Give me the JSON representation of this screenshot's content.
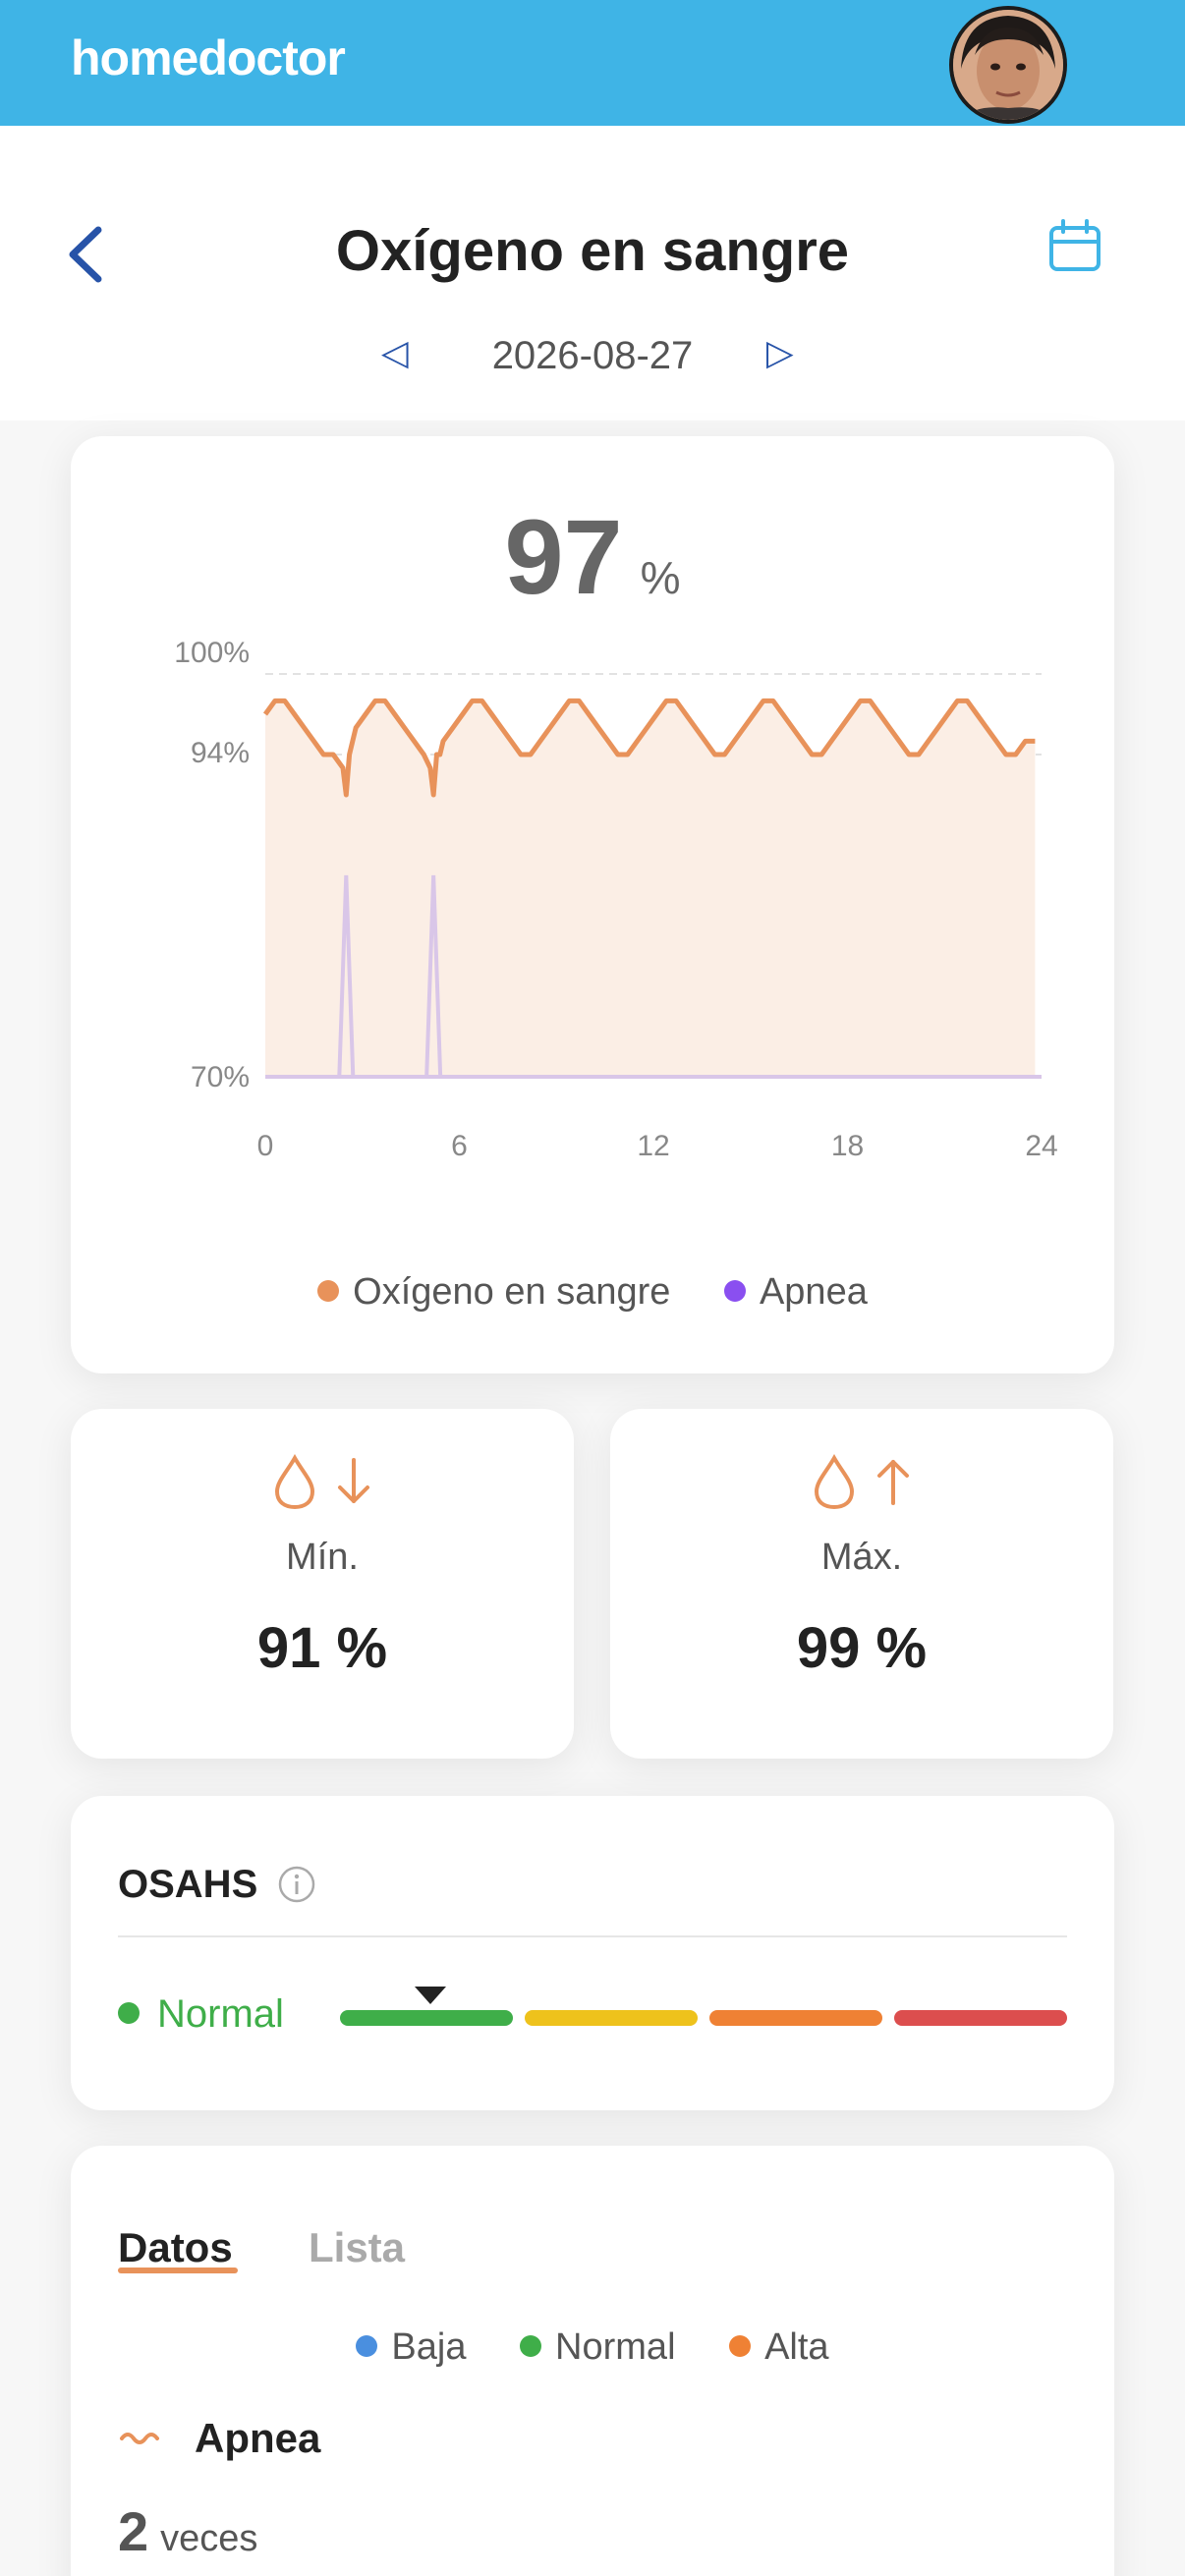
{
  "app": {
    "logo_text": "homedoctor",
    "avatar_icon": "user-avatar"
  },
  "header": {
    "title": "Oxígeno en sangre",
    "date": "2026-08-27",
    "prev_icon": "triangle-left-icon",
    "next_icon": "triangle-right-icon",
    "back_icon": "chevron-left-icon",
    "calendar_icon": "calendar-icon"
  },
  "summary": {
    "value": "97",
    "unit": "%"
  },
  "chart_data": {
    "type": "area",
    "y_tick_labels": [
      "100%",
      "94%",
      "70%"
    ],
    "y_ticks": [
      100,
      94,
      70
    ],
    "x_ticks": [
      "0",
      "6",
      "12",
      "18",
      "24"
    ],
    "xlim": [
      0,
      24
    ],
    "ylim": [
      70,
      100
    ],
    "series": [
      {
        "name": "Oxígeno en sangre",
        "color": "#e8925a",
        "x": [
          0,
          0.3,
          0.6,
          0.9,
          1.2,
          1.5,
          1.8,
          2.1,
          2.4,
          2.5,
          2.6,
          2.7,
          2.8,
          3.1,
          3.4,
          3.7,
          4.0,
          4.3,
          4.6,
          4.9,
          5.1,
          5.2,
          5.3,
          5.4,
          5.5,
          5.8,
          6.1,
          6.4,
          6.7,
          7.0,
          7.3,
          7.6,
          7.9,
          8.2,
          8.5,
          8.8,
          9.1,
          9.4,
          9.7,
          10.0,
          10.3,
          10.6,
          10.9,
          11.2,
          11.5,
          11.8,
          12.1,
          12.4,
          12.7,
          13.0,
          13.3,
          13.6,
          13.9,
          14.2,
          14.5,
          14.8,
          15.1,
          15.4,
          15.7,
          16.0,
          16.3,
          16.6,
          16.9,
          17.2,
          17.5,
          17.8,
          18.1,
          18.4,
          18.7,
          19.0,
          19.3,
          19.6,
          19.9,
          20.2,
          20.5,
          20.8,
          21.1,
          21.4,
          21.7,
          22.0,
          22.3,
          22.6,
          22.9,
          23.2,
          23.5,
          23.8
        ],
        "values": [
          97,
          98,
          98,
          97,
          96,
          95,
          94,
          94,
          93,
          91,
          94,
          95,
          96,
          97,
          98,
          98,
          97,
          96,
          95,
          94,
          93,
          91,
          94,
          94,
          95,
          96,
          97,
          98,
          98,
          97,
          96,
          95,
          94,
          94,
          95,
          96,
          97,
          98,
          98,
          97,
          96,
          95,
          94,
          94,
          95,
          96,
          97,
          98,
          98,
          97,
          96,
          95,
          94,
          94,
          95,
          96,
          97,
          98,
          98,
          97,
          96,
          95,
          94,
          94,
          95,
          96,
          97,
          98,
          98,
          97,
          96,
          95,
          94,
          94,
          95,
          96,
          97,
          98,
          98,
          97,
          96,
          95,
          94,
          94,
          95,
          95
        ]
      },
      {
        "name": "Apnea",
        "color": "#d9c6e8",
        "events_x": [
          2.5,
          5.2
        ],
        "event_peak": 85
      }
    ],
    "legend": [
      {
        "label": "Oxígeno en sangre",
        "color": "#e8925a"
      },
      {
        "label": "Apnea",
        "color": "#8a4ff0"
      }
    ]
  },
  "min_card": {
    "label": "Mín.",
    "value": "91 %",
    "icons": [
      "drop-icon",
      "arrow-down-icon"
    ],
    "color": "#e8925a"
  },
  "max_card": {
    "label": "Máx.",
    "value": "99 %",
    "icons": [
      "drop-icon",
      "arrow-up-icon"
    ],
    "color": "#e8925a"
  },
  "osahs": {
    "title": "OSAHS",
    "info_icon": "info-icon",
    "status": "Normal",
    "status_color": "#3fae49",
    "scale_colors": [
      "#3fae49",
      "#eec21c",
      "#ef8134",
      "#dc4e4e"
    ],
    "marker_level": 0
  },
  "data_section": {
    "tabs": [
      {
        "label": "Datos",
        "active": true
      },
      {
        "label": "Lista",
        "active": false
      }
    ],
    "legend": [
      {
        "label": "Baja",
        "color": "#4a8fdf"
      },
      {
        "label": "Normal",
        "color": "#3fae49"
      },
      {
        "label": "Alta",
        "color": "#ef8134"
      }
    ],
    "apnea_title": "Apnea",
    "apnea_icon": "wave-icon",
    "apnea_count": "2",
    "apnea_unit": "veces"
  }
}
